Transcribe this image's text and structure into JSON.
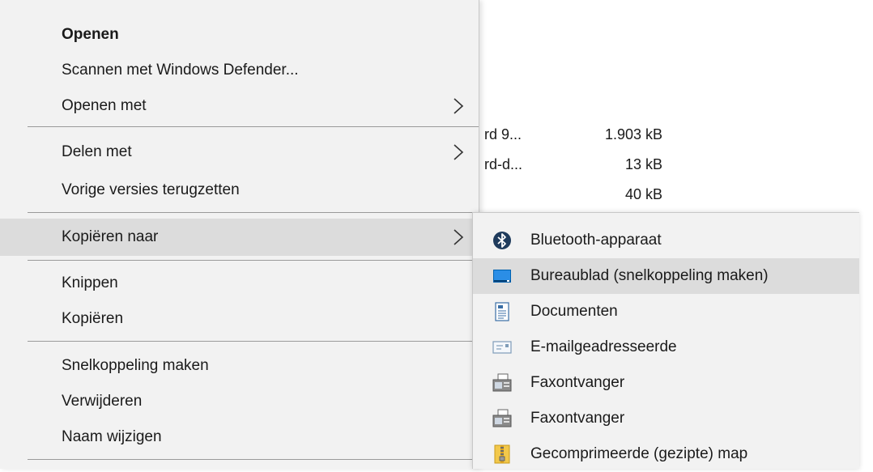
{
  "background_files": [
    {
      "name": "rd 9...",
      "size": "1.903 kB"
    },
    {
      "name": "rd-d...",
      "size": "13 kB"
    },
    {
      "name": "",
      "size": "40 kB"
    }
  ],
  "context_menu": {
    "items": [
      {
        "label": "Openen"
      },
      {
        "label": "Scannen met Windows Defender..."
      },
      {
        "label": "Openen met"
      },
      {
        "label": "Delen met"
      },
      {
        "label": "Vorige versies terugzetten"
      },
      {
        "label": "Kopiëren naar"
      },
      {
        "label": "Knippen"
      },
      {
        "label": "Kopiëren"
      },
      {
        "label": "Snelkoppeling maken"
      },
      {
        "label": "Verwijderen"
      },
      {
        "label": "Naam wijzigen"
      }
    ]
  },
  "submenu": {
    "items": [
      {
        "label": "Bluetooth-apparaat",
        "icon": "bluetooth-icon"
      },
      {
        "label": "Bureaublad (snelkoppeling maken)",
        "icon": "desktop-icon"
      },
      {
        "label": "Documenten",
        "icon": "documents-icon"
      },
      {
        "label": "E-mailgeadresseerde",
        "icon": "mail-recipient-icon"
      },
      {
        "label": "Faxontvanger",
        "icon": "fax-icon"
      },
      {
        "label": "Faxontvanger",
        "icon": "fax-icon"
      },
      {
        "label": "Gecomprimeerde (gezipte) map",
        "icon": "zip-folder-icon"
      }
    ]
  },
  "colors": {
    "menu_background": "#f2f2f2",
    "hover_background": "#dcdcdc",
    "bluetooth_blue": "#0078d7"
  }
}
